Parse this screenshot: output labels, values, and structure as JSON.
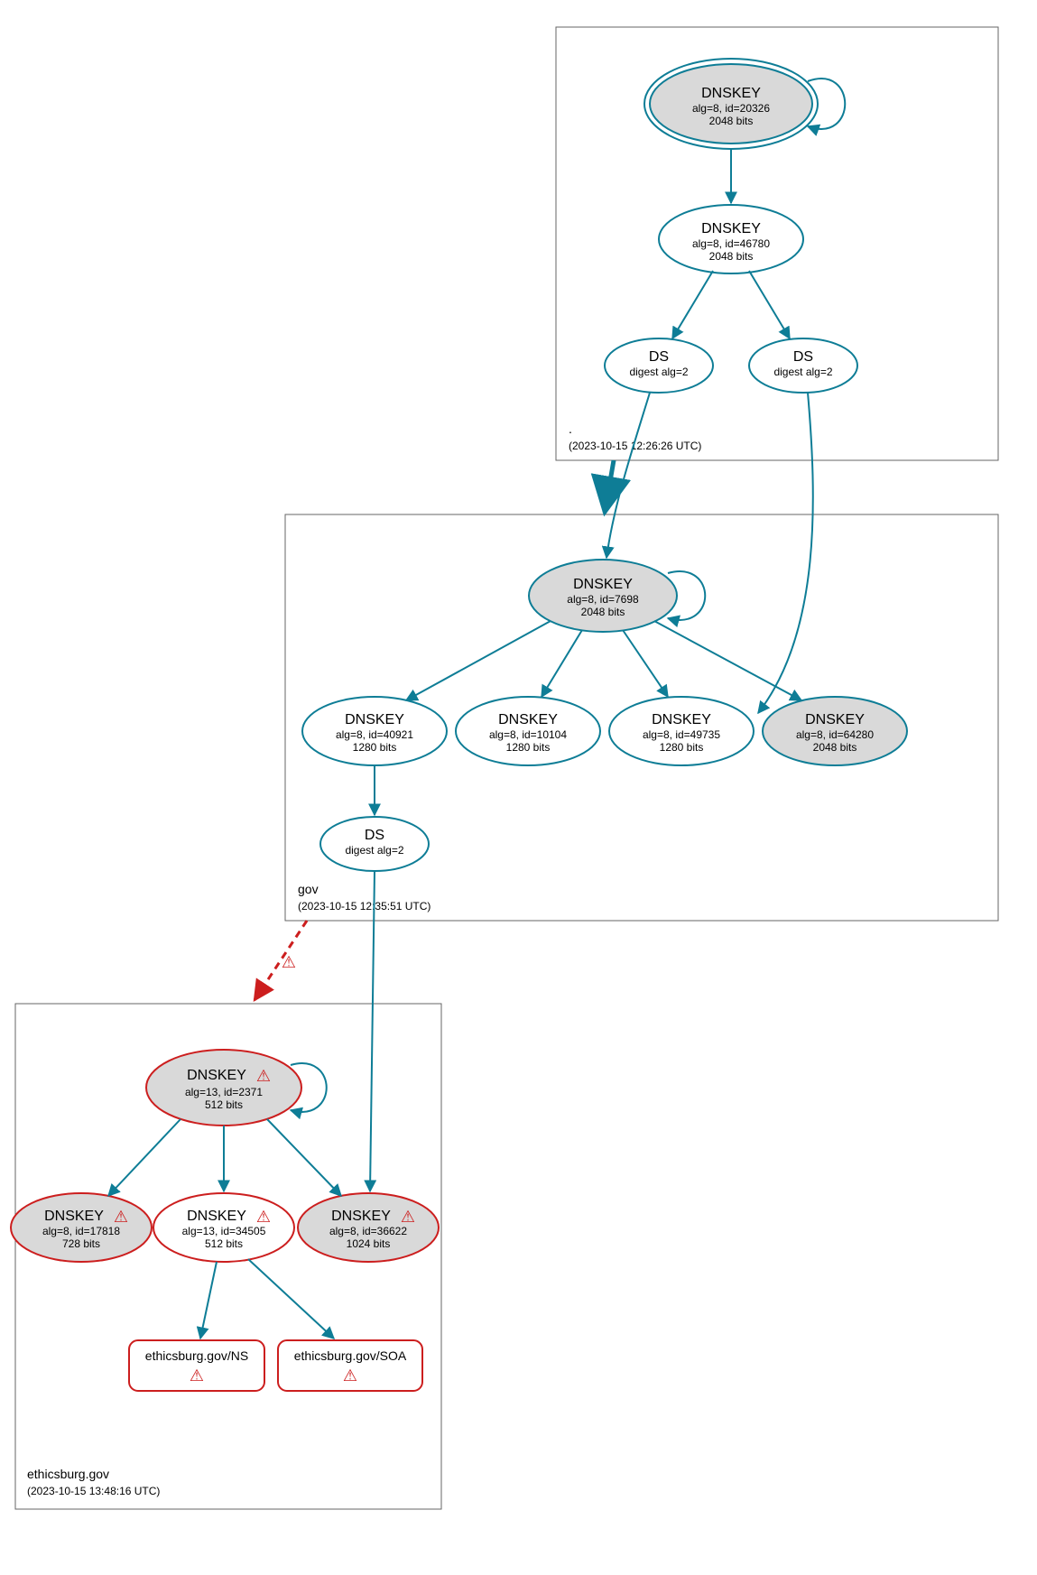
{
  "zones": {
    "root": {
      "name": ".",
      "timestamp": "(2023-10-15 12:26:26 UTC)",
      "nodes": {
        "dnskey_20326": {
          "title": "DNSKEY",
          "line1": "alg=8, id=20326",
          "line2": "2048 bits"
        },
        "dnskey_46780": {
          "title": "DNSKEY",
          "line1": "alg=8, id=46780",
          "line2": "2048 bits"
        },
        "ds_1": {
          "title": "DS",
          "line1": "digest alg=2"
        },
        "ds_2": {
          "title": "DS",
          "line1": "digest alg=2"
        }
      }
    },
    "gov": {
      "name": "gov",
      "timestamp": "(2023-10-15 12:35:51 UTC)",
      "nodes": {
        "dnskey_7698": {
          "title": "DNSKEY",
          "line1": "alg=8, id=7698",
          "line2": "2048 bits"
        },
        "dnskey_40921": {
          "title": "DNSKEY",
          "line1": "alg=8, id=40921",
          "line2": "1280 bits"
        },
        "dnskey_10104": {
          "title": "DNSKEY",
          "line1": "alg=8, id=10104",
          "line2": "1280 bits"
        },
        "dnskey_49735": {
          "title": "DNSKEY",
          "line1": "alg=8, id=49735",
          "line2": "1280 bits"
        },
        "dnskey_64280": {
          "title": "DNSKEY",
          "line1": "alg=8, id=64280",
          "line2": "2048 bits"
        },
        "ds_3": {
          "title": "DS",
          "line1": "digest alg=2"
        }
      }
    },
    "ethicsburg": {
      "name": "ethicsburg.gov",
      "timestamp": "(2023-10-15 13:48:16 UTC)",
      "nodes": {
        "dnskey_2371": {
          "title": "DNSKEY",
          "line1": "alg=13, id=2371",
          "line2": "512 bits"
        },
        "dnskey_17818": {
          "title": "DNSKEY",
          "line1": "alg=8, id=17818",
          "line2": "728 bits"
        },
        "dnskey_34505": {
          "title": "DNSKEY",
          "line1": "alg=13, id=34505",
          "line2": "512 bits"
        },
        "dnskey_36622": {
          "title": "DNSKEY",
          "line1": "alg=8, id=36622",
          "line2": "1024 bits"
        },
        "ns": {
          "title": "ethicsburg.gov/NS"
        },
        "soa": {
          "title": "ethicsburg.gov/SOA"
        }
      }
    }
  },
  "icons": {
    "warn": "⚠"
  }
}
